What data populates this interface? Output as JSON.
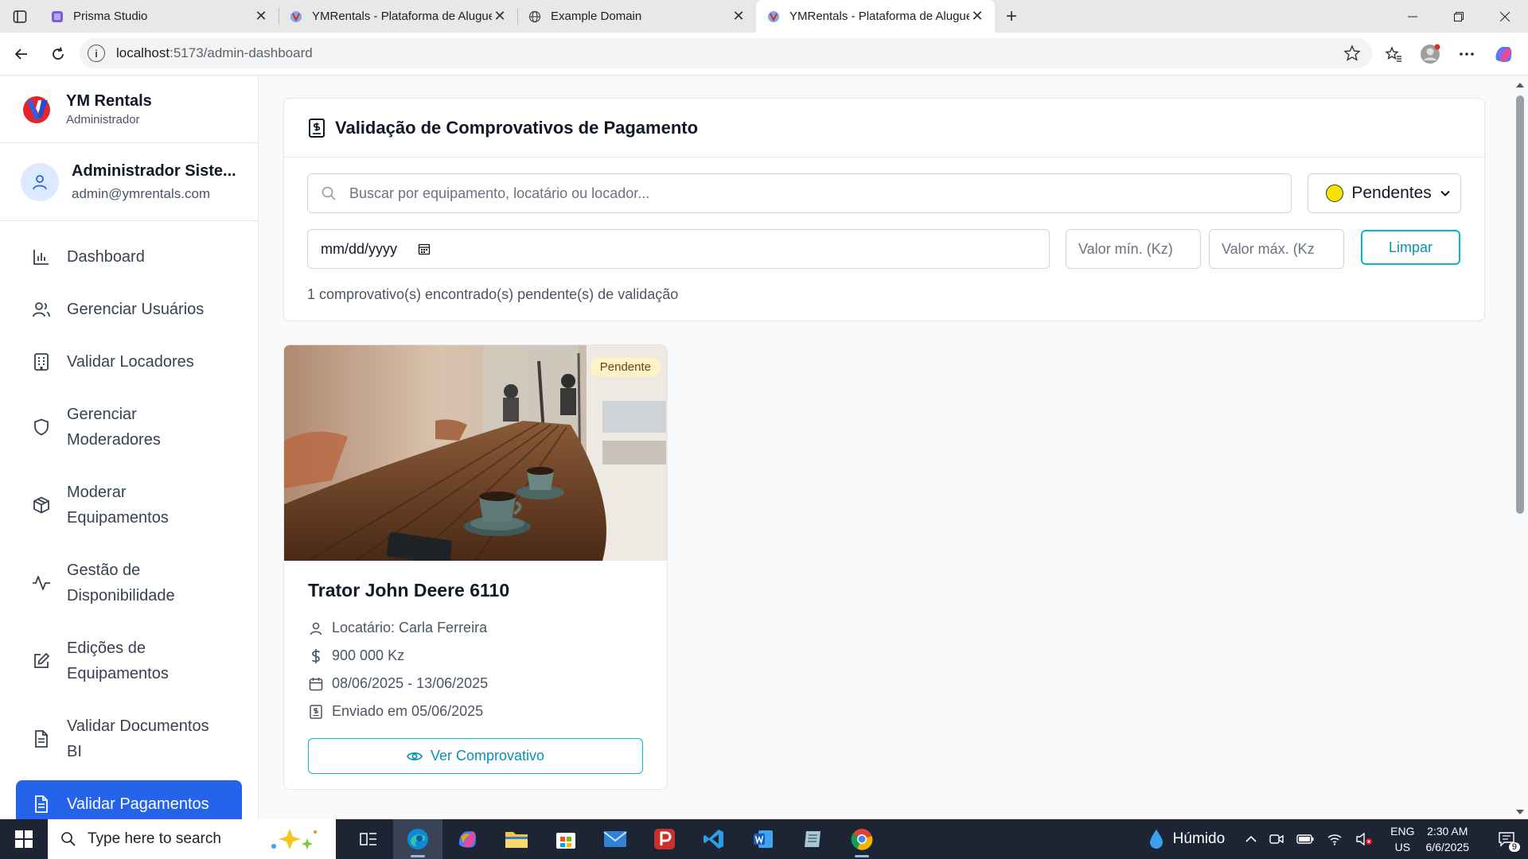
{
  "browser": {
    "tabs": [
      {
        "title": "Prisma Studio",
        "favicon": "prisma-icon",
        "active": false
      },
      {
        "title": "YMRentals - Plataforma de Aluguel",
        "favicon": "ym-logo-icon",
        "active": false
      },
      {
        "title": "Example Domain",
        "favicon": "globe-icon",
        "active": false
      },
      {
        "title": "YMRentals - Plataforma de Aluguel",
        "favicon": "ym-logo-icon",
        "active": true
      }
    ],
    "new_tab_label": "+",
    "url_host": "localhost",
    "url_path": ":5173/admin-dashboard"
  },
  "sidebar": {
    "brand_name": "YM Rentals",
    "brand_role": "Administrador",
    "user_name": "Administrador Siste...",
    "user_email": "admin@ymrentals.com",
    "items": [
      {
        "label": "Dashboard",
        "icon": "bar-chart-icon",
        "active": false
      },
      {
        "label": "Gerenciar Usuários",
        "icon": "users-icon",
        "active": false
      },
      {
        "label": "Validar Locadores",
        "icon": "building-icon",
        "active": false
      },
      {
        "label": "Gerenciar Moderadores",
        "icon": "shield-icon",
        "active": false
      },
      {
        "label": "Moderar Equipamentos",
        "icon": "package-icon",
        "active": false
      },
      {
        "label": "Gestão de Disponibilidade",
        "icon": "activity-icon",
        "active": false
      },
      {
        "label": "Edições de Equipamentos",
        "icon": "edit-icon",
        "active": false
      },
      {
        "label": "Validar Documentos BI",
        "icon": "file-icon",
        "active": false
      },
      {
        "label": "Validar Pagamentos",
        "icon": "file-text-icon",
        "active": true
      }
    ]
  },
  "main": {
    "title": "Validação de Comprovativos de Pagamento",
    "search_placeholder": "Buscar por equipamento, locatário ou locador...",
    "status_value": "Pendentes",
    "date_placeholder": "mm/dd/yyyy",
    "min_placeholder": "Valor mín. (Kz)",
    "max_placeholder": "Valor máx. (Kz",
    "clear_label": "Limpar",
    "count_text": "1 comprovativo(s) encontrado(s) pendente(s) de validação"
  },
  "card": {
    "badge": "Pendente",
    "title": "Trator John Deere 6110",
    "tenant": "Locatário: Carla Ferreira",
    "amount": "900 000 Kz",
    "period": "08/06/2025 - 13/06/2025",
    "sent": "Enviado em 05/06/2025",
    "button": "Ver Comprovativo"
  },
  "taskbar": {
    "search_placeholder": "Type here to search",
    "weather": "Húmido",
    "lang_1": "ENG",
    "lang_2": "US",
    "time": "2:30 AM",
    "date": "6/6/2025",
    "notifications": "9"
  },
  "colors": {
    "accent": "#2563eb",
    "cyan": "#06b6d4",
    "badge_bg": "#fef3c7"
  }
}
